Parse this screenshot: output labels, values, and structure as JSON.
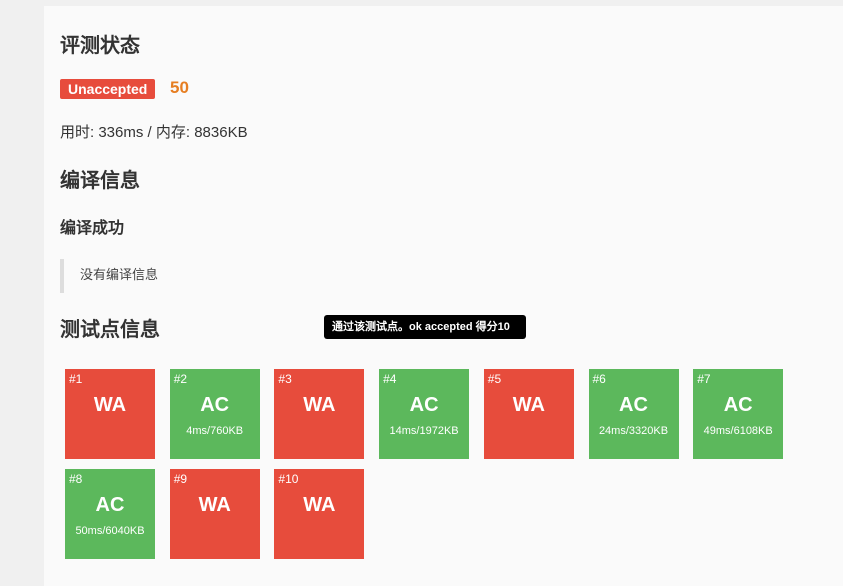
{
  "status_title": "评测状态",
  "status": {
    "badge": "Unaccepted",
    "score": "50",
    "stats": "用时: 336ms / 内存: 8836KB"
  },
  "compile": {
    "title": "编译信息",
    "result": "编译成功",
    "message": "没有编译信息"
  },
  "testpoints": {
    "title": "测试点信息",
    "tooltip": "通过该测试点。ok accepted 得分10",
    "cases": [
      {
        "num": "#1",
        "result": "WA",
        "detail": ""
      },
      {
        "num": "#2",
        "result": "AC",
        "detail": "4ms/760KB"
      },
      {
        "num": "#3",
        "result": "WA",
        "detail": ""
      },
      {
        "num": "#4",
        "result": "AC",
        "detail": "14ms/1972KB"
      },
      {
        "num": "#5",
        "result": "WA",
        "detail": ""
      },
      {
        "num": "#6",
        "result": "AC",
        "detail": "24ms/3320KB"
      },
      {
        "num": "#7",
        "result": "AC",
        "detail": "49ms/6108KB"
      },
      {
        "num": "#8",
        "result": "AC",
        "detail": "50ms/6040KB"
      },
      {
        "num": "#9",
        "result": "WA",
        "detail": ""
      },
      {
        "num": "#10",
        "result": "WA",
        "detail": ""
      }
    ]
  },
  "colors": {
    "accepted": "#5cb85c",
    "wrong_answer": "#e74c3c",
    "score": "#e67e22"
  }
}
